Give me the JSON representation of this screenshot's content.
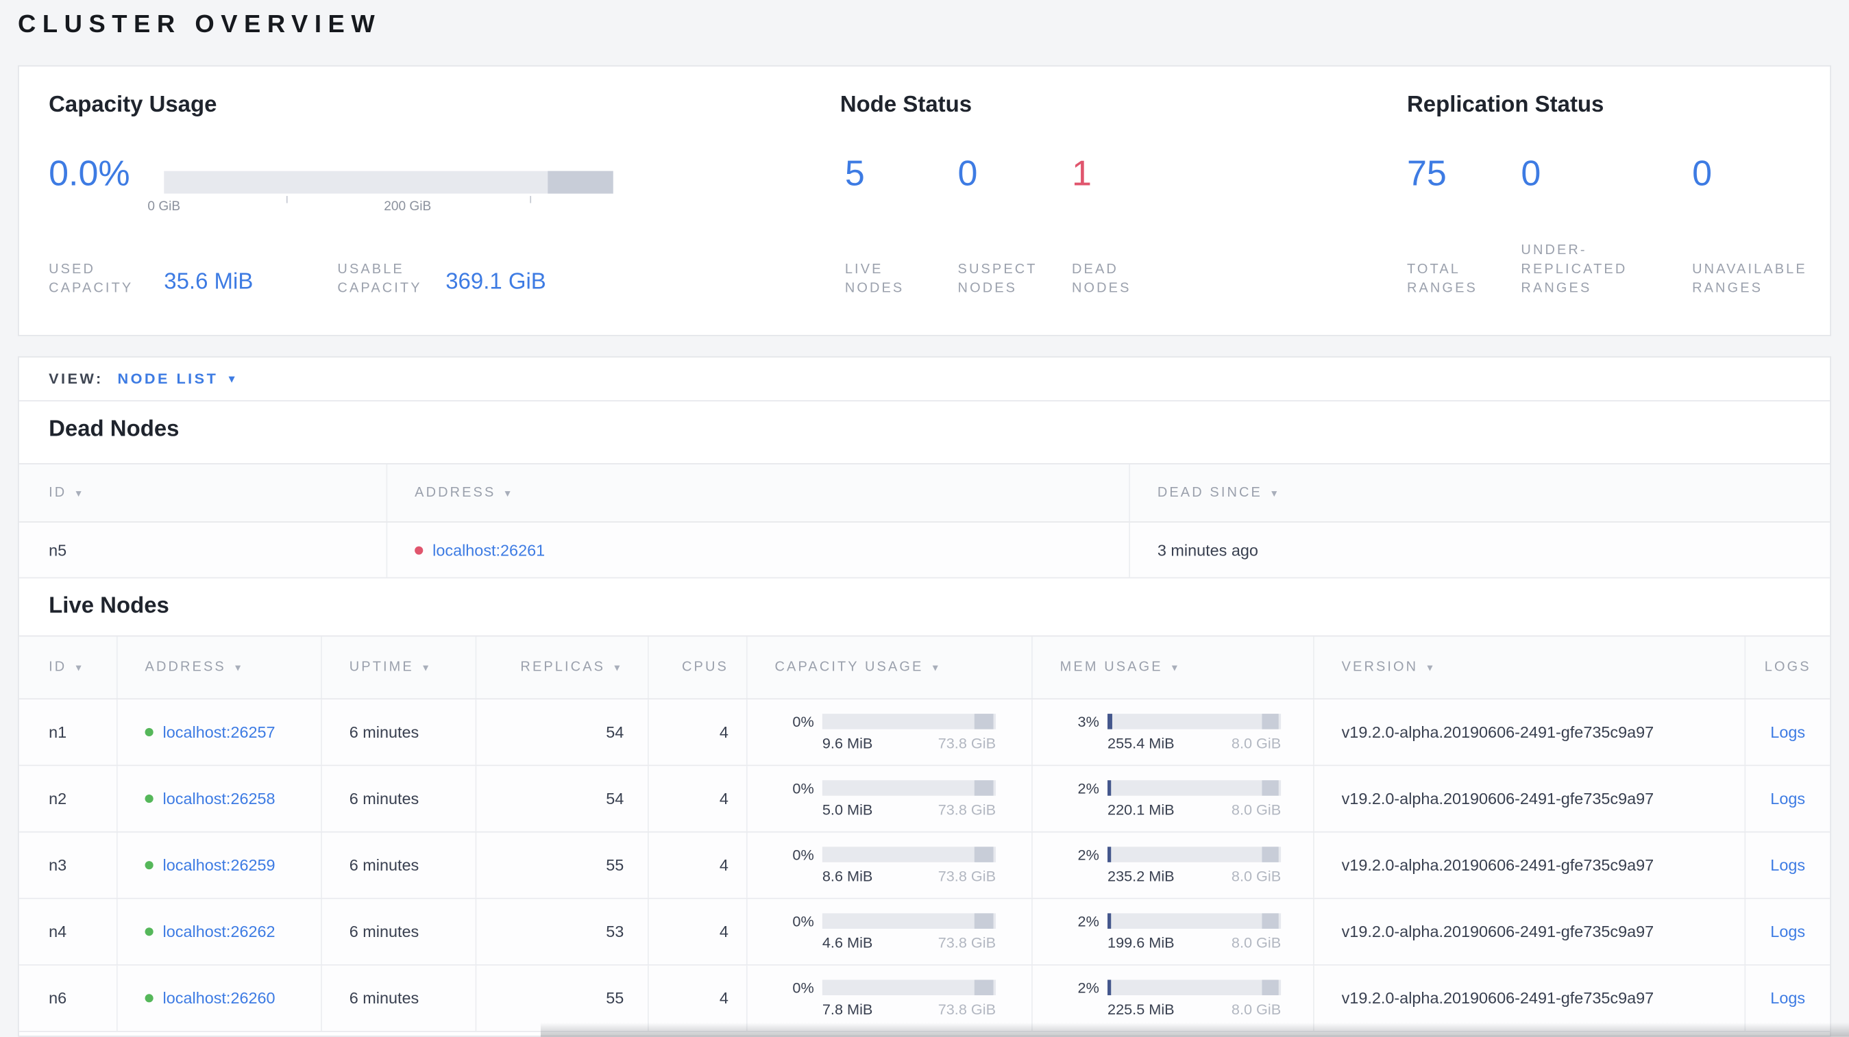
{
  "page": {
    "title": "CLUSTER OVERVIEW"
  },
  "colors": {
    "accent_blue": "#3d7be3",
    "danger_red": "#e0556d",
    "healthy_green": "#55b75a"
  },
  "summary": {
    "capacity": {
      "heading": "Capacity Usage",
      "percent": "0.0%",
      "tick_labels": [
        "0 GiB",
        "200 GiB"
      ],
      "used": {
        "label": "USED CAPACITY",
        "value": "35.6 MiB"
      },
      "usable": {
        "label": "USABLE CAPACITY",
        "value": "369.1 GiB"
      }
    },
    "node_status": {
      "heading": "Node Status",
      "stats": [
        {
          "value": "5",
          "label": "LIVE NODES"
        },
        {
          "value": "0",
          "label": "SUSPECT NODES"
        },
        {
          "value": "1",
          "label": "DEAD NODES"
        }
      ]
    },
    "replication": {
      "heading": "Replication Status",
      "stats": [
        {
          "value": "75",
          "label": "TOTAL RANGES"
        },
        {
          "value": "0",
          "label": "UNDER-REPLICATED RANGES"
        },
        {
          "value": "0",
          "label": "UNAVAILABLE RANGES"
        }
      ]
    }
  },
  "view_bar": {
    "label": "VIEW:",
    "selected": "NODE LIST"
  },
  "dead_nodes": {
    "heading": "Dead Nodes",
    "columns": {
      "id": "ID",
      "address": "ADDRESS",
      "dead_since": "DEAD SINCE"
    },
    "rows": [
      {
        "id": "n5",
        "address": "localhost:26261",
        "dead_since": "3 minutes ago"
      }
    ]
  },
  "live_nodes": {
    "heading": "Live Nodes",
    "columns": {
      "id": "ID",
      "address": "ADDRESS",
      "uptime": "UPTIME",
      "replicas": "REPLICAS",
      "cpus": "CPUS",
      "capacity": "CAPACITY USAGE",
      "memory": "MEM USAGE",
      "version": "VERSION",
      "logs": "LOGS"
    },
    "rows": [
      {
        "id": "n1",
        "address": "localhost:26257",
        "uptime": "6 minutes",
        "replicas": "54",
        "cpus": "4",
        "capacity_pct": "0%",
        "capacity_used": "9.6 MiB",
        "capacity_total": "73.8 GiB",
        "mem_pct": "3%",
        "mem_used": "255.4 MiB",
        "mem_total": "8.0 GiB",
        "version": "v19.2.0-alpha.20190606-2491-gfe735c9a97",
        "logs_label": "Logs"
      },
      {
        "id": "n2",
        "address": "localhost:26258",
        "uptime": "6 minutes",
        "replicas": "54",
        "cpus": "4",
        "capacity_pct": "0%",
        "capacity_used": "5.0 MiB",
        "capacity_total": "73.8 GiB",
        "mem_pct": "2%",
        "mem_used": "220.1 MiB",
        "mem_total": "8.0 GiB",
        "version": "v19.2.0-alpha.20190606-2491-gfe735c9a97",
        "logs_label": "Logs"
      },
      {
        "id": "n3",
        "address": "localhost:26259",
        "uptime": "6 minutes",
        "replicas": "55",
        "cpus": "4",
        "capacity_pct": "0%",
        "capacity_used": "8.6 MiB",
        "capacity_total": "73.8 GiB",
        "mem_pct": "2%",
        "mem_used": "235.2 MiB",
        "mem_total": "8.0 GiB",
        "version": "v19.2.0-alpha.20190606-2491-gfe735c9a97",
        "logs_label": "Logs"
      },
      {
        "id": "n4",
        "address": "localhost:26262",
        "uptime": "6 minutes",
        "replicas": "53",
        "cpus": "4",
        "capacity_pct": "0%",
        "capacity_used": "4.6 MiB",
        "capacity_total": "73.8 GiB",
        "mem_pct": "2%",
        "mem_used": "199.6 MiB",
        "mem_total": "8.0 GiB",
        "version": "v19.2.0-alpha.20190606-2491-gfe735c9a97",
        "logs_label": "Logs"
      },
      {
        "id": "n6",
        "address": "localhost:26260",
        "uptime": "6 minutes",
        "replicas": "55",
        "cpus": "4",
        "capacity_pct": "0%",
        "capacity_used": "7.8 MiB",
        "capacity_total": "73.8 GiB",
        "mem_pct": "2%",
        "mem_used": "225.5 MiB",
        "mem_total": "8.0 GiB",
        "version": "v19.2.0-alpha.20190606-2491-gfe735c9a97",
        "logs_label": "Logs"
      }
    ]
  }
}
